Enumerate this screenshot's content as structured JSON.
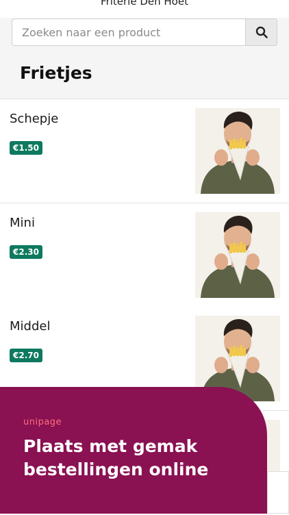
{
  "header": {
    "title": "Friterie Den Hoet"
  },
  "search": {
    "placeholder": "Zoeken naar een product",
    "icon": "search-icon"
  },
  "category": {
    "title": "Frietjes"
  },
  "items": [
    {
      "name": "Schepje",
      "price": "€1.50"
    },
    {
      "name": "Mini",
      "price": "€2.30"
    },
    {
      "name": "Middel",
      "price": "€2.70"
    }
  ],
  "banner": {
    "brand": "unipage",
    "headline": "Plaats met gemak bestellingen online"
  },
  "colors": {
    "price_badge": "#0d7a5f",
    "banner_bg": "#8a1152",
    "brand_accent": "#ff6f7d"
  }
}
